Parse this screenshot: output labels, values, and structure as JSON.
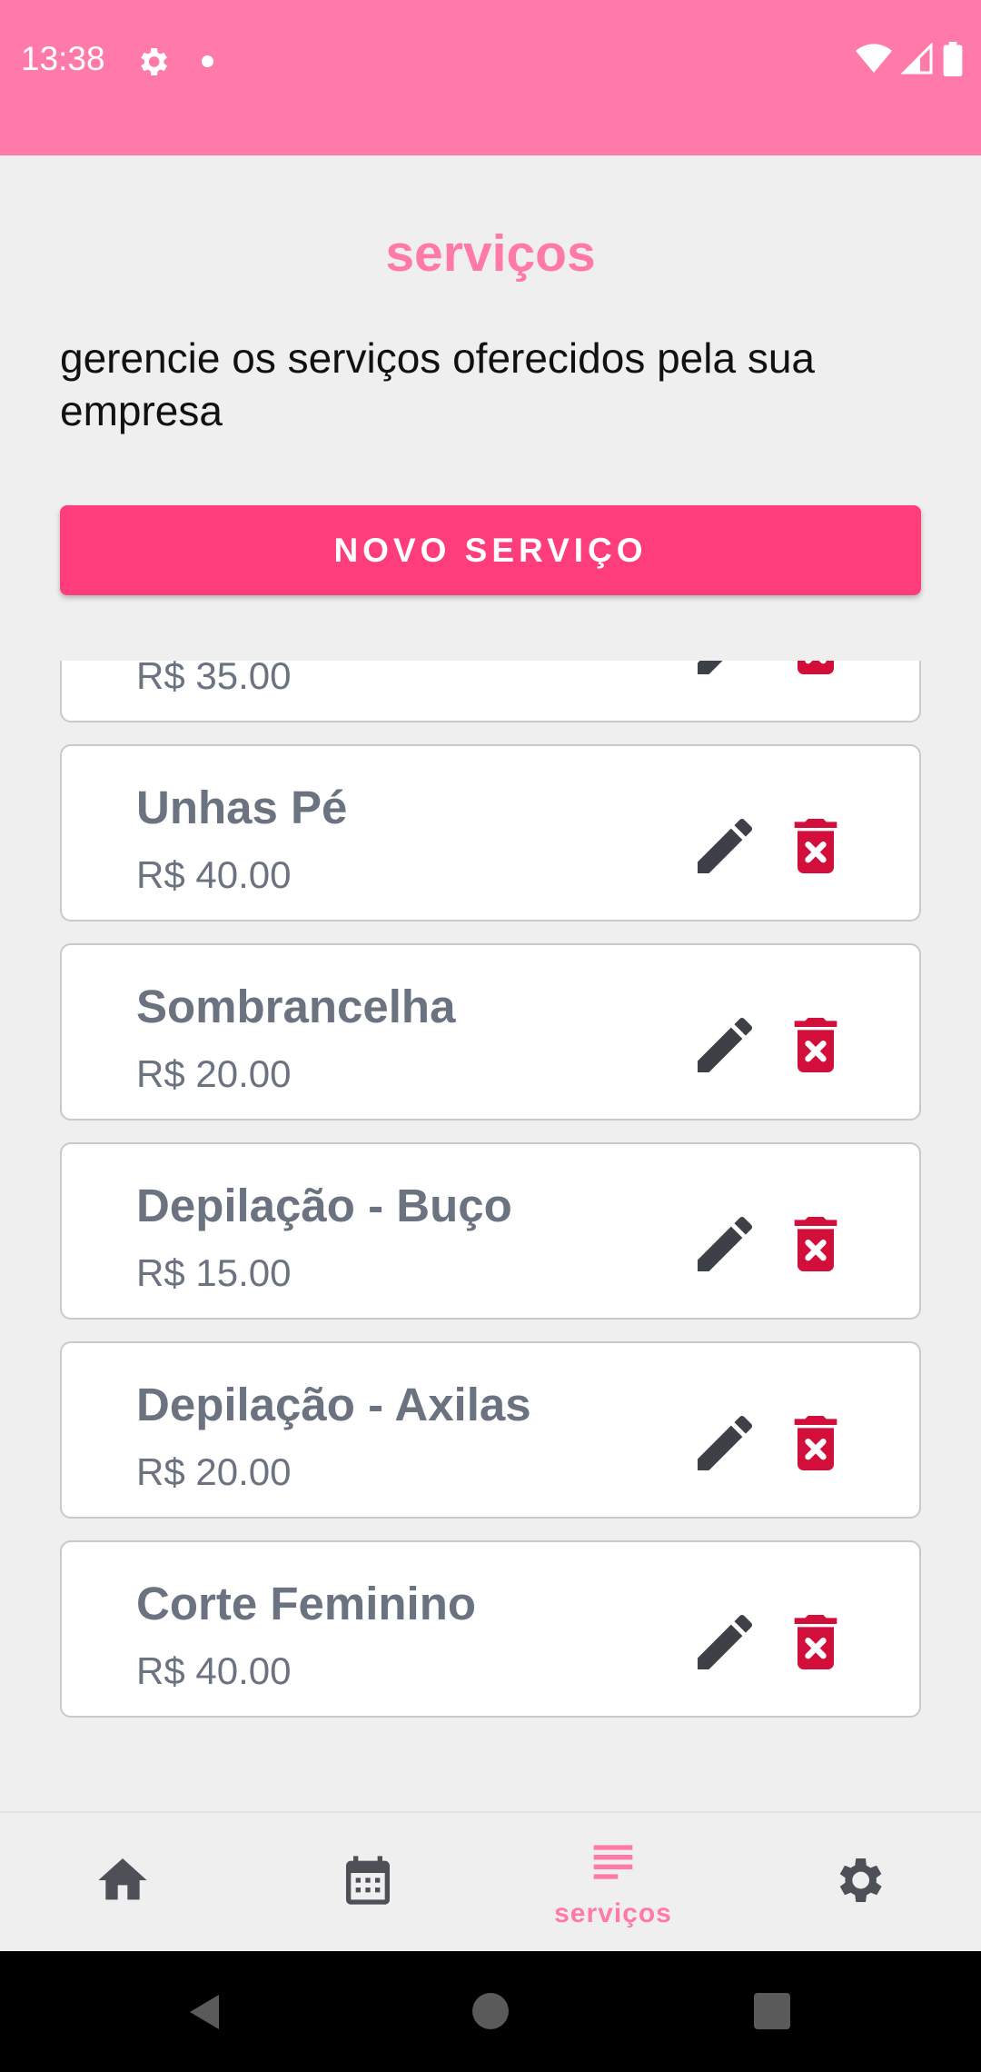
{
  "status_bar": {
    "time": "13:38",
    "icons": [
      "gear-icon",
      "notification-dot",
      "wifi-icon",
      "signal-icon",
      "battery-icon"
    ]
  },
  "header": {
    "title": "serviços",
    "subtitle": "gerencie os serviços oferecidos pela sua empresa"
  },
  "actions": {
    "new_service_label": "NOVO SERVIÇO"
  },
  "services": [
    {
      "name": "",
      "price": "R$ 35.00"
    },
    {
      "name": "Unhas Pé",
      "price": "R$ 40.00"
    },
    {
      "name": "Sombrancelha",
      "price": "R$ 20.00"
    },
    {
      "name": "Depilação - Buço",
      "price": "R$ 15.00"
    },
    {
      "name": "Depilação - Axilas",
      "price": "R$ 20.00"
    },
    {
      "name": "Corte Feminino",
      "price": "R$ 40.00"
    }
  ],
  "bottom_nav": {
    "items": [
      {
        "icon": "home-icon",
        "label": ""
      },
      {
        "icon": "calendar-icon",
        "label": ""
      },
      {
        "icon": "list-icon",
        "label": "serviços",
        "active": true
      },
      {
        "icon": "settings-icon",
        "label": ""
      }
    ]
  },
  "colors": {
    "brand_pink": "#ff7aa8",
    "button_pink": "#ff3d7a",
    "delete_red": "#d10f3a",
    "edit_dark": "#3d4147",
    "text_gray": "#6b7280",
    "background": "#efefef"
  }
}
